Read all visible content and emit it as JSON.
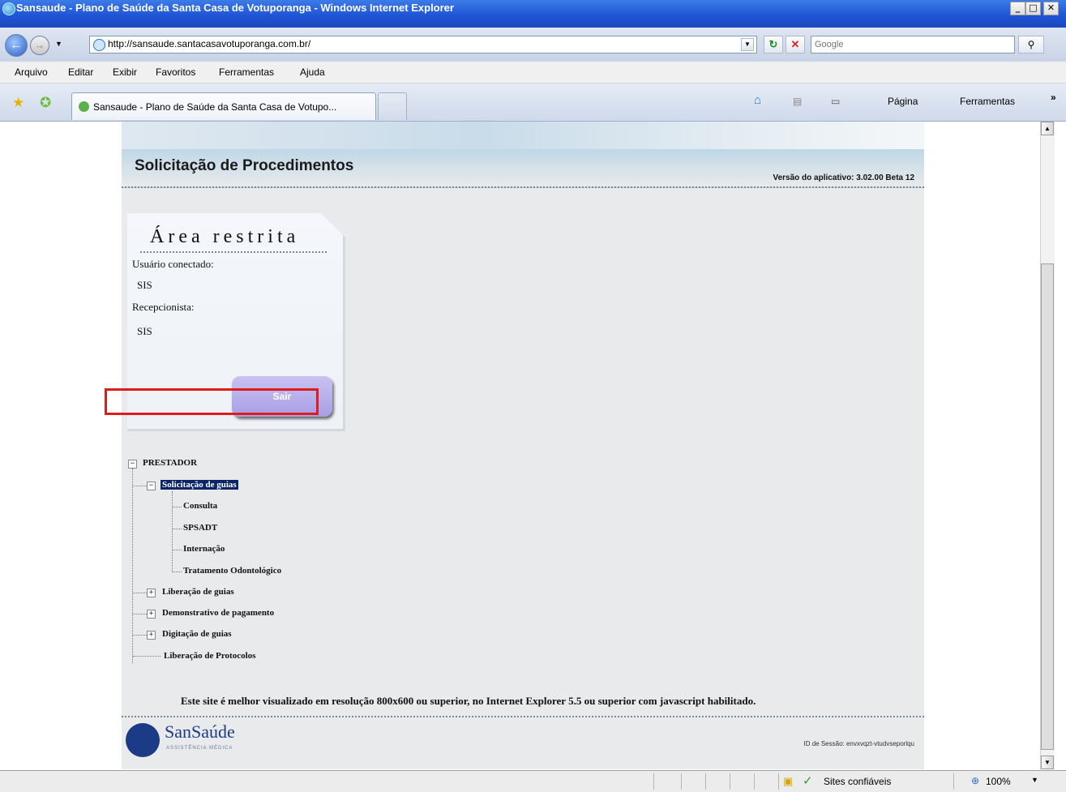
{
  "window": {
    "title": "Sansaude - Plano de Saúde da Santa Casa de Votuporanga - Windows Internet Explorer",
    "controls": {
      "minimize": "_",
      "maximize": "□",
      "close": "✕"
    }
  },
  "toolbar": {
    "back_icon": "←",
    "forward_icon": "→",
    "dropdown_icon": "▼",
    "url": "http://sansaude.santacasavotuporanga.com.br/",
    "refresh_icon": "↻",
    "stop_icon": "✕",
    "search_placeholder": "Google",
    "search_icon": "⚲"
  },
  "menu": [
    "Arquivo",
    "Editar",
    "Exibir",
    "Favoritos",
    "Ferramentas",
    "Ajuda"
  ],
  "tabs": {
    "active_label": "Sansaude - Plano de Saúde da Santa Casa de Votupo...",
    "home_icon": "⌂",
    "feeds_icon": "▤",
    "print_icon": "▭",
    "page_menu": "Página",
    "tools_menu": "Ferramentas",
    "more": "»"
  },
  "page": {
    "title": "Solicitação de Procedimentos",
    "version": "Versão do aplicativo: 3.02.00 Beta 12",
    "restricted": {
      "title": "Área restrita",
      "user_label": "Usuário conectado:",
      "user_value": "SIS",
      "recep_label": "Recepcionista:",
      "recep_value": "SIS",
      "logout": "Sair"
    },
    "tree": {
      "root": "PRESTADOR",
      "group1": "Solicitação de guias",
      "items": [
        "Consulta",
        "SPSADT",
        "Internação",
        "Tratamento Odontológico"
      ],
      "group2": "Liberação de guias",
      "group3": "Demonstrativo de pagamento",
      "group4": "Digitação de guias",
      "leaf": "Liberação de Protocolos"
    },
    "footnote": "Este site é melhor visualizado em resolução 800x600 ou superior, no Internet Explorer 5.5 ou superior com javascript habilitado.",
    "logo_text": "SanSaúde",
    "logo_sub": "ASSISTÊNCIA MÉDICA",
    "id_label": "ID de Sessão: envxvqzt-vtudvseporlqu"
  },
  "status": {
    "zone": "Sites confiáveis",
    "zoom": "100%"
  },
  "colors": {
    "highlight_box": "#e01b1b",
    "selected_node": "#0a246a",
    "logout_button": "#b7aeeb"
  }
}
